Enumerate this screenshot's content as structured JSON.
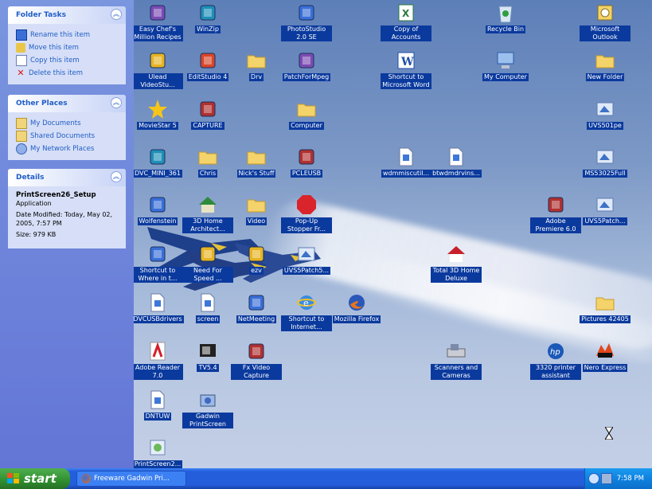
{
  "task_pane": {
    "folder_tasks": {
      "title": "Folder Tasks",
      "items": [
        "Rename this item",
        "Move this item",
        "Copy this item",
        "Delete this item"
      ]
    },
    "other_places": {
      "title": "Other Places",
      "items": [
        "My Documents",
        "Shared Documents",
        "My Network Places"
      ]
    },
    "details": {
      "title": "Details",
      "name": "PrintScreen26_Setup",
      "type": "Application",
      "modified": "Date Modified: Today, May 02, 2005, 7:57 PM",
      "size": "Size: 979 KB"
    }
  },
  "desktop_icons": [
    {
      "label": "Easy Chef's Million Recipes",
      "icon": "chef-hat-icon"
    },
    {
      "label": "WinZip",
      "icon": "winzip-icon"
    },
    {
      "label": "PhotoStudio 2.0 SE",
      "icon": "photostudio-icon"
    },
    {
      "label": "Copy of Accounts",
      "icon": "excel-file-icon"
    },
    {
      "label": "Recycle Bin",
      "icon": "recycle-bin-icon"
    },
    {
      "label": "Microsoft Outlook",
      "icon": "outlook-icon"
    },
    {
      "label": "Ulead VideoStu...",
      "icon": "ulead-icon"
    },
    {
      "label": "EditStudio 4",
      "icon": "editstudio-icon"
    },
    {
      "label": "Drv",
      "icon": "folder-icon"
    },
    {
      "label": "PatchForMpeg",
      "icon": "patch-icon"
    },
    {
      "label": "Shortcut to Microsoft Word",
      "icon": "word-icon"
    },
    {
      "label": "My Computer",
      "icon": "my-computer-icon"
    },
    {
      "label": "New Folder",
      "icon": "folder-icon"
    },
    {
      "label": "MovieStar 5",
      "icon": "star-icon"
    },
    {
      "label": "CAPTURE",
      "icon": "capture-icon"
    },
    {
      "label": "Computer",
      "icon": "folder-icon"
    },
    {
      "label": "UVS501pe",
      "icon": "installer-icon"
    },
    {
      "label": "DVC_MINI_361",
      "icon": "dvc-icon"
    },
    {
      "label": "Chris",
      "icon": "folder-icon"
    },
    {
      "label": "Nick's Stuff",
      "icon": "folder-icon"
    },
    {
      "label": "PCLEUSB",
      "icon": "pcleusb-icon"
    },
    {
      "label": "wdmmiscutil...",
      "icon": "file-icon"
    },
    {
      "label": "btwdmdrvins...",
      "icon": "file-icon"
    },
    {
      "label": "MS53025Full",
      "icon": "installer-icon"
    },
    {
      "label": "Wolfenstein",
      "icon": "wolfenstein-icon"
    },
    {
      "label": "3D Home Architect...",
      "icon": "house-icon"
    },
    {
      "label": "Video",
      "icon": "folder-icon"
    },
    {
      "label": "Pop-Up Stopper Fr...",
      "icon": "popup-stopper-icon"
    },
    {
      "label": "Adobe Premiere 6.0",
      "icon": "premiere-icon"
    },
    {
      "label": "UVS5Patch...",
      "icon": "installer-icon"
    },
    {
      "label": "Shortcut to Where in t...",
      "icon": "where-icon"
    },
    {
      "label": "Need For Speed ...",
      "icon": "nfs-icon"
    },
    {
      "label": "ezv",
      "icon": "ezv-icon"
    },
    {
      "label": "UVS5Patch5...",
      "icon": "installer-icon"
    },
    {
      "label": "Total 3D Home Deluxe",
      "icon": "house3d-icon"
    },
    {
      "label": "DVCUSBdrivers",
      "icon": "file-icon"
    },
    {
      "label": "screen",
      "icon": "file-icon"
    },
    {
      "label": "NetMeeting",
      "icon": "netmeeting-icon"
    },
    {
      "label": "Shortcut to Internet...",
      "icon": "ie-icon"
    },
    {
      "label": "Mozilla Firefox",
      "icon": "firefox-icon"
    },
    {
      "label": "Pictures 42405",
      "icon": "folder-icon"
    },
    {
      "label": "Adobe Reader 7.0",
      "icon": "adobe-reader-icon"
    },
    {
      "label": "TV5.4",
      "icon": "tv-icon"
    },
    {
      "label": "Fx Video Capture",
      "icon": "fx-video-icon"
    },
    {
      "label": "Scanners and Cameras",
      "icon": "scanner-icon"
    },
    {
      "label": "3320 printer assistant",
      "icon": "hp-icon"
    },
    {
      "label": "Nero Express",
      "icon": "nero-icon"
    },
    {
      "label": "DNTUW",
      "icon": "file-icon"
    },
    {
      "label": "Gadwin PrintScreen",
      "icon": "gadwin-icon"
    },
    {
      "label": "PrintScreen2...",
      "icon": "setup-icon"
    }
  ],
  "taskbar": {
    "start_label": "start",
    "window_button": "Freeware Gadwin Pri...",
    "clock": "7:58 PM"
  },
  "colors": {
    "label_bg": "#0b3a9e",
    "taskbar": "#245edb",
    "start": "#2f8f2f",
    "pane_link": "#215dc6"
  }
}
